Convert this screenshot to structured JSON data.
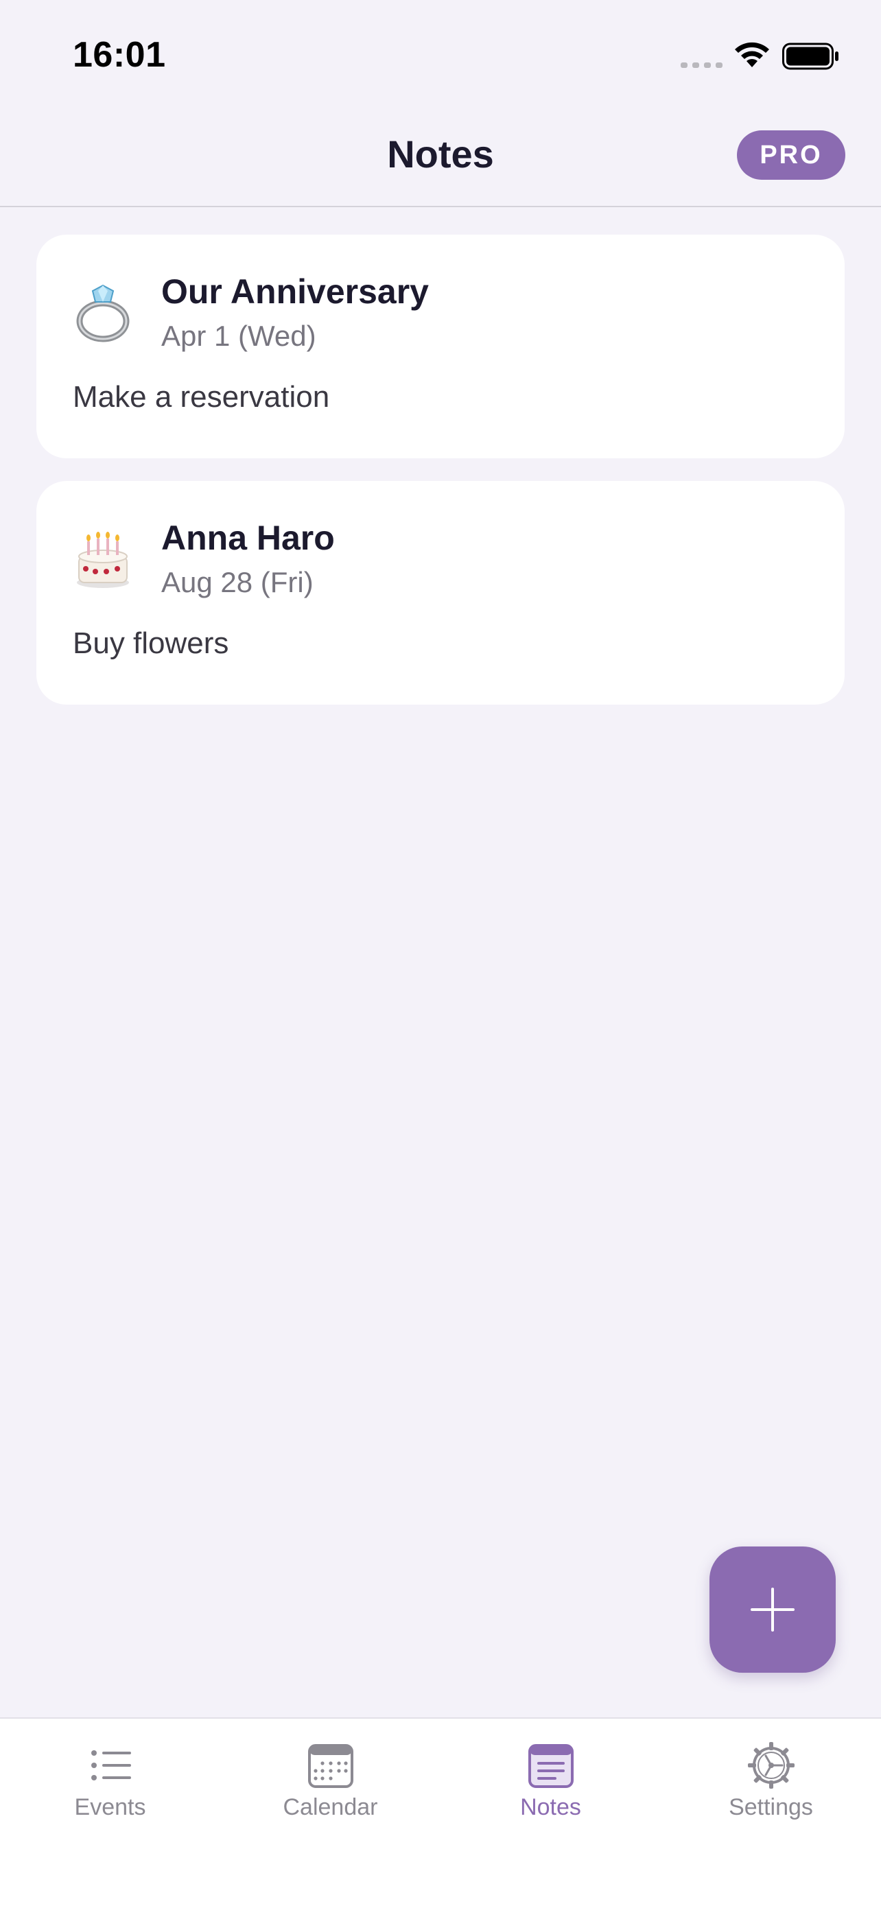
{
  "status_bar": {
    "time": "16:01"
  },
  "nav": {
    "title": "Notes",
    "pro_badge": "PRO"
  },
  "notes": [
    {
      "icon": "ring-emoji",
      "title": "Our Anniversary",
      "date": "Apr 1 (Wed)",
      "note": "Make a reservation"
    },
    {
      "icon": "birthday-cake-emoji",
      "title": "Anna Haro",
      "date": "Aug 28 (Fri)",
      "note": "Buy flowers"
    }
  ],
  "fab": {
    "icon": "plus-icon"
  },
  "tab_bar": {
    "tabs": [
      {
        "label": "Events",
        "icon": "list-icon",
        "active": false
      },
      {
        "label": "Calendar",
        "icon": "calendar-icon",
        "active": false
      },
      {
        "label": "Notes",
        "icon": "notes-icon",
        "active": true
      },
      {
        "label": "Settings",
        "icon": "gear-icon",
        "active": false
      }
    ]
  },
  "colors": {
    "accent": "#8b6bb1",
    "background": "#f4f2f9",
    "card": "#ffffff",
    "text_primary": "#1c1a2e",
    "text_secondary": "#77757f",
    "tab_inactive": "#8c8a92"
  }
}
